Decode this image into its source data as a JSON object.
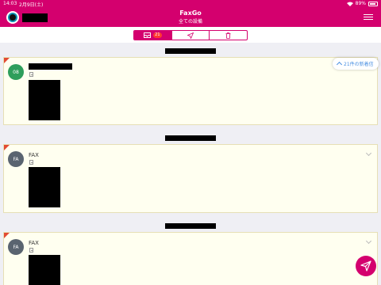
{
  "status_bar": {
    "time": "14:03",
    "date": "2月9日(土)",
    "battery": "89%"
  },
  "header": {
    "title": "FaxGo",
    "subtitle": "全ての設備"
  },
  "tabs": [
    {
      "name": "inbox",
      "icon": "inbox-icon",
      "badge": "21",
      "active": true
    },
    {
      "name": "sent",
      "icon": "send-icon",
      "active": false
    },
    {
      "name": "trash",
      "icon": "trash-icon",
      "active": false
    }
  ],
  "new_arrivals": {
    "label": "21件の新着信"
  },
  "groups": [
    {
      "items": [
        {
          "avatar_text": "08",
          "avatar_color": "#2e9e5b",
          "sender": ""
        }
      ]
    },
    {
      "items": [
        {
          "avatar_text": "FA",
          "avatar_color": "#5a6470",
          "sender": "FAX"
        }
      ]
    },
    {
      "items": [
        {
          "avatar_text": "FA",
          "avatar_color": "#5a6470",
          "sender": "FAX"
        }
      ]
    }
  ],
  "colors": {
    "brand": "#d4006e",
    "unread_marker": "#e24a33",
    "card_bg": "#fffff0",
    "link": "#4a90e2"
  }
}
